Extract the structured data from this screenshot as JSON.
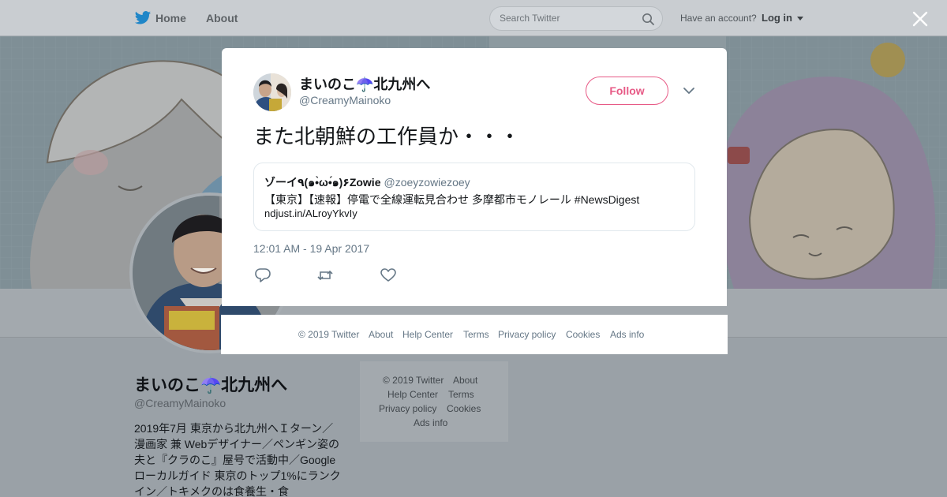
{
  "topbar": {
    "home_label": "Home",
    "about_label": "About",
    "search_placeholder": "Search Twitter",
    "account_question": "Have an account?",
    "login_label": "Log in"
  },
  "profile": {
    "name": "まいのこ☂️北九州へ",
    "handle": "@CreamyMainoko",
    "bio": "2019年7月 東京から北九州へＩターン／漫画家 兼 Webデザイナー／ペンギン姿の夫と『クラのこ』屋号で活動中／Googleローカルガイド 東京のトップ1%にランクイン／トキメクのは食養生・食"
  },
  "side_footer": {
    "copyright": "© 2019 Twitter",
    "about": "About",
    "help": "Help Center",
    "terms": "Terms",
    "privacy": "Privacy policy",
    "cookies": "Cookies",
    "ads": "Ads info"
  },
  "tweet": {
    "author_name": "まいのこ☂️北九州へ",
    "author_handle": "@CreamyMainoko",
    "follow_label": "Follow",
    "text": "また北朝鮮の工作員か・・・",
    "timestamp": "12:01 AM - 19 Apr 2017",
    "quoted": {
      "name": "ゾーイ٩(๑•̀ω•́๑)۶Zowie",
      "handle": "@zoeyzowiezoey",
      "text": "【東京】【速報】停電で全線運転見合わせ 多摩都市モノレール #NewsDigest",
      "link": "ndjust.in/ALroyYkvIy"
    }
  },
  "modal_footer": {
    "copyright": "© 2019 Twitter",
    "about": "About",
    "help": "Help Center",
    "terms": "Terms",
    "privacy": "Privacy policy",
    "cookies": "Cookies",
    "ads": "Ads info"
  },
  "icons": {
    "brand": "twitter-bird-icon",
    "search": "search-icon",
    "close": "close-icon",
    "chevron": "chevron-down-icon",
    "reply": "reply-icon",
    "retweet": "retweet-icon",
    "like": "heart-icon"
  },
  "colors": {
    "twitter_blue": "#1da1f2",
    "follow_pink": "#e0245e",
    "secondary_text": "#657786"
  }
}
